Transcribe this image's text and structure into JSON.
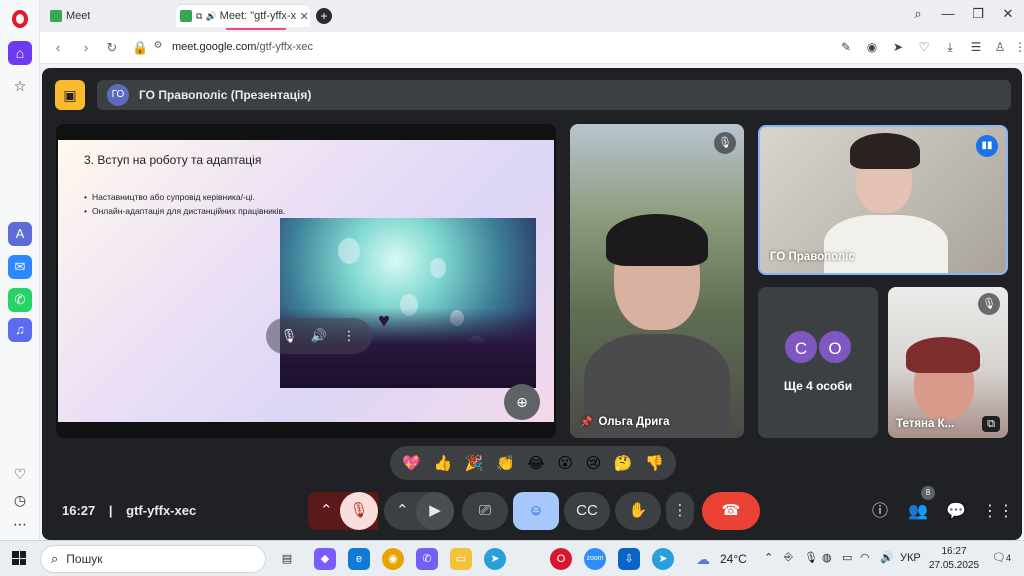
{
  "browser": {
    "tabs": [
      {
        "title": "Meet",
        "active": false
      },
      {
        "title": "Meet: \"gtf-yffx-xec",
        "active": true
      }
    ],
    "new_tab_label": "+",
    "url_host": "meet.google.com",
    "url_path": "/gtf-yffx-xec"
  },
  "meet": {
    "presenter_avatar": "ГО",
    "presentation_title": "ГО Правополіс (Презентація)",
    "slide": {
      "heading": "3. Вступ на роботу та адаптація",
      "bullets": [
        "Наставництво або супровід керівника/-ці.",
        "Онлайн-адаптація для дистанційних працівників."
      ]
    },
    "participants": [
      {
        "name": "Ольга Дрига",
        "muted": true,
        "pinned": true
      },
      {
        "name": "ГО Правополіс",
        "speaking": true
      },
      {
        "name": "Тетяна К..."
      }
    ],
    "others": {
      "initials": [
        "С",
        "О"
      ],
      "label": "Ще 4 особи"
    },
    "reactions": [
      "💖",
      "👍",
      "🎉",
      "👏",
      "😂",
      "😮",
      "😢",
      "🤔",
      "👎"
    ],
    "time": "16:27",
    "meeting_code": "gtf-yffx-xec",
    "people_count": "8"
  },
  "taskbar": {
    "search_placeholder": "Пошук",
    "weather": "24°C",
    "language": "УКР",
    "clock_time": "16:27",
    "clock_date": "27.05.2025",
    "notifications": "4"
  },
  "colors": {
    "accent": "#6c3bf0",
    "meet_bg": "#202124",
    "end_call": "#ea4335",
    "present_badge": "#f9ba2e"
  }
}
